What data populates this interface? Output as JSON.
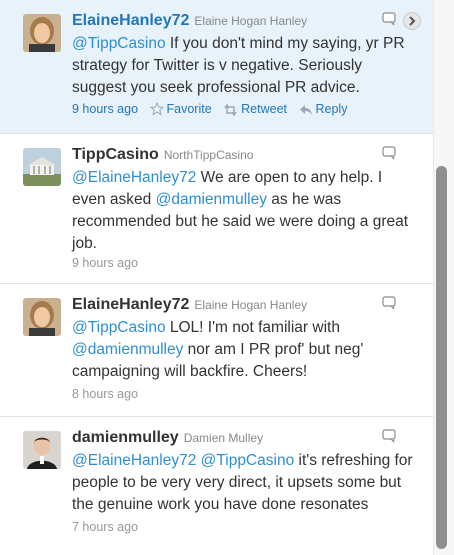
{
  "tweets": [
    {
      "screen_name": "ElaineHanley72",
      "full_name": "Elaine Hogan Hanley",
      "text_parts": [
        {
          "text": "@TippCasino",
          "mention": true
        },
        {
          "text": " If you don't mind my saying, yr PR strategy for Twitter is v negative. Seriously suggest you seek professional PR advice.",
          "mention": false
        }
      ],
      "timestamp": "9 hours ago",
      "actions": {
        "favorite": "Favorite",
        "retweet": "Retweet",
        "reply": "Reply"
      },
      "avatar_icon": "profile-photo-icon"
    },
    {
      "screen_name": "TippCasino",
      "full_name": "NorthTippCasino",
      "text_parts": [
        {
          "text": "@ElaineHanley72",
          "mention": true
        },
        {
          "text": " We are open to any help. I even asked ",
          "mention": false
        },
        {
          "text": "@damienmulley",
          "mention": true
        },
        {
          "text": " as he was recommended but he said we were doing a great job.",
          "mention": false
        }
      ],
      "timestamp": "9 hours ago",
      "avatar_icon": "building-photo-icon"
    },
    {
      "screen_name": "ElaineHanley72",
      "full_name": "Elaine Hogan Hanley",
      "text_parts": [
        {
          "text": "@TippCasino",
          "mention": true
        },
        {
          "text": " LOL! I'm not familiar with ",
          "mention": false
        },
        {
          "text": "@damienmulley",
          "mention": true
        },
        {
          "text": " nor am I PR prof' but neg' campaigning will backfire. Cheers!",
          "mention": false
        }
      ],
      "timestamp": "8 hours ago",
      "avatar_icon": "profile-photo-icon"
    },
    {
      "screen_name": "damienmulley",
      "full_name": "Damien Mulley",
      "text_parts": [
        {
          "text": "@ElaineHanley72",
          "mention": true
        },
        {
          "text": " ",
          "mention": false
        },
        {
          "text": "@TippCasino",
          "mention": true
        },
        {
          "text": " it's refreshing for people to be very very direct, it upsets some but the genuine work you have done resonates",
          "mention": false
        }
      ],
      "timestamp": "7 hours ago",
      "avatar_icon": "profile-photo-icon"
    }
  ],
  "colors": {
    "link": "#2f8fcf",
    "highlight_bg": "#e8f2fa",
    "text": "#333333",
    "meta": "#999999"
  }
}
